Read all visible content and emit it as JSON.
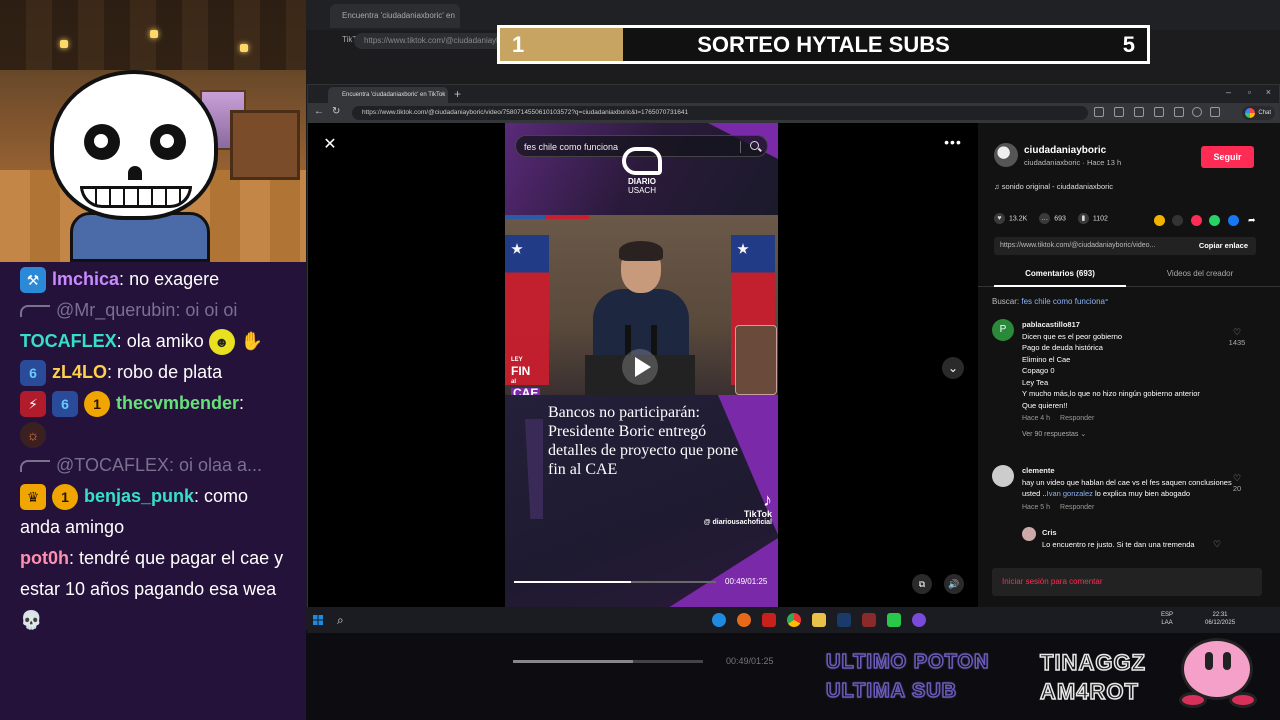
{
  "raffle": {
    "left_number": "1",
    "title": "SORTEO HYTALE SUBS",
    "right_number": "5"
  },
  "chat": {
    "messages": [
      {
        "user": "lmchica",
        "text": " no exagere",
        "color": "#c78bff"
      },
      {
        "reply_to": "@Mr_querubin: oi oi oi"
      },
      {
        "user": "TOCAFLEX",
        "text": " ola amiko",
        "color": "#36e0c8"
      },
      {
        "user": "zL4LO",
        "text": " robo de plata",
        "color": "#ffd04a"
      },
      {
        "user": "thecvmbender",
        "text": "",
        "color": "#66e07a"
      },
      {
        "reply_to": "@TOCAFLEX: oi olaa a..."
      },
      {
        "user": "benjas_punk",
        "text": " como anda amingo",
        "color": "#36e0c8"
      },
      {
        "user": "pot0h",
        "text": " tendré que pagar el cae y estar 10 años pagando esa wea",
        "color": "#ff8fb0"
      }
    ]
  },
  "bg_window": {
    "tab": "Encuentra 'ciudadaniaxboric' en TikTok",
    "url": "https://www.tiktok.com/@ciudadaniayboric/video...",
    "time": "00:49/01:25"
  },
  "browser": {
    "tab_title": "Encuentra 'ciudadaniaxboric' en TikTok",
    "url": "https://www.tiktok.com/@ciudadaniayboric/video/7580714550610103572?q=ciudadaniaxboric&t=1765070731641",
    "chat_label": "Chat"
  },
  "video": {
    "search_text": "fes chile como funciona",
    "brand_name": "DIARIO",
    "brand_sub": "USACH",
    "ley_a": "LEY",
    "ley_b": "FIN",
    "ley_c": "CAE",
    "ley_d": "al",
    "headline": "Bancos no participarán: Presidente Boric entregó detalles de proyecto que pone fin al CAE",
    "tiktok_word": "TikTok",
    "tiktok_handle": "@ diariousachoficial",
    "time": "00:49/01:25",
    "progress": 0.58
  },
  "panel": {
    "username": "ciudadaniayboric",
    "subline": "ciudadaniaxboric · Hace 13 h",
    "follow": "Seguir",
    "music": "sonido original - ciudadaniaxboric",
    "likes": "13.2K",
    "comments": "693",
    "saves": "1102",
    "link": "https://www.tiktok.com/@ciudadaniayboric/video...",
    "copy": "Copiar enlace",
    "tab_comments": "Comentarios (693)",
    "tab_videos": "Videos del creador",
    "search_label": "Buscar:",
    "search_query": "fes chile como funciona",
    "c1": {
      "avatar": "P",
      "user": "pablacastillo817",
      "lines": [
        "Dicen que es el peor gobierno",
        "Pago de deuda histórica",
        "Elimino el Cae",
        "Copago 0",
        "Ley Tea",
        "Y mucho más,lo que no hizo ningún gobierno anterior",
        "Que quieren!!"
      ],
      "time": "Hace 4 h",
      "reply": "Responder",
      "likes": "1435",
      "replies": "Ver 90 respuestas"
    },
    "c2": {
      "user": "clemente",
      "text_a": "hay un video que hablan del cae vs el fes saquen conclusiones usted ..",
      "mention": "Ivan gonzalez",
      "text_b": " lo explica muy bien abogado",
      "time": "Hace 5 h",
      "reply": "Responder",
      "likes": "20"
    },
    "c3": {
      "user": "Cris",
      "text": "Lo encuentro re justo. Si te dan una tremenda"
    },
    "login": "Iniciar sesión para comentar"
  },
  "taskbar": {
    "lang_a": "ESP",
    "lang_b": "LAA",
    "time": "22:31",
    "date": "06/12/2025"
  },
  "overlay": {
    "ultimo_a": "ULTIMO POTON",
    "ultimo_b": "ULTIMA SUB",
    "tinaggz_a": "TINAGGZ",
    "tinaggz_b": "AM4ROT"
  },
  "colors": {
    "accent": "#fe2c55",
    "chat_bg": "#24123a",
    "purple": "#7a2aa8"
  }
}
